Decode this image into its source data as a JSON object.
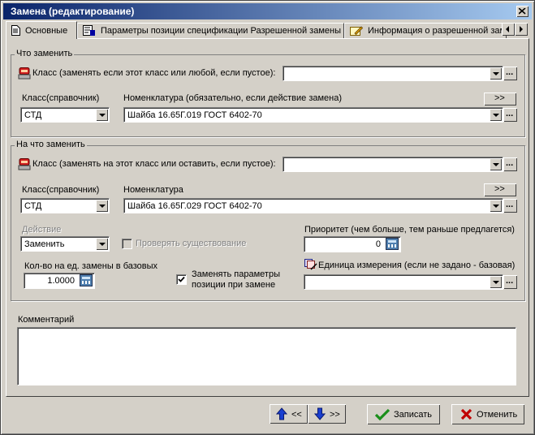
{
  "window": {
    "title": "Замена (редактирование)"
  },
  "tabs": [
    {
      "label": "Основные",
      "icon": "document-icon"
    },
    {
      "label": "Параметры позиции спецификации Разрешенной замены",
      "icon": "spec-params-icon"
    },
    {
      "label": "Информация о разрешенной заме",
      "icon": "info-edit-icon"
    }
  ],
  "what_group": {
    "title": "Что заменить",
    "class_label": "Класс (заменять если этот класс или любой, если пустое):",
    "class_value": "",
    "class_ref_label": "Класс(справочник)",
    "class_ref_value": "СТД",
    "nomenclature_label": "Номенклатура (обязательно, если действие замена)",
    "nomenclature_value": "Шайба 16.65Г.019 ГОСТ 6402-70",
    "more_button": ">>"
  },
  "to_group": {
    "title": "На что заменить",
    "class_label": "Класс (заменять на этот класс или оставить, если пустое):",
    "class_value": "",
    "class_ref_label": "Класс(справочник)",
    "class_ref_value": "СТД",
    "nomenclature_label": "Номенклатура",
    "nomenclature_value": "Шайба 16.65Г.029 ГОСТ 6402-70",
    "more_button": ">>",
    "action_label": "Действие",
    "action_value": "Заменить",
    "check_existence_label": "Проверять существование",
    "priority_label": "Приоритет (чем больше, тем раньше предлагется)",
    "priority_value": "0",
    "qty_label": "Кол-во на ед. замены в базовых",
    "qty_value": "1.0000",
    "replace_params_label_1": "Заменять параметры",
    "replace_params_label_2": "позиции при замене",
    "replace_params_checked": true,
    "unit_label": "Единица измерения (если не задано - базовая)",
    "unit_value": ""
  },
  "comment": {
    "label": "Комментарий",
    "value": ""
  },
  "footer": {
    "prev_label": "<<",
    "next_label": ">>",
    "save_label": "Записать",
    "cancel_label": "Отменить"
  },
  "colors": {
    "title_start": "#0a246a",
    "title_end": "#a6caf0",
    "face": "#d4d0c8",
    "save_check": "#1a8f1a",
    "cancel_x": "#c00000",
    "arrow_blue": "#1a3fd0"
  }
}
